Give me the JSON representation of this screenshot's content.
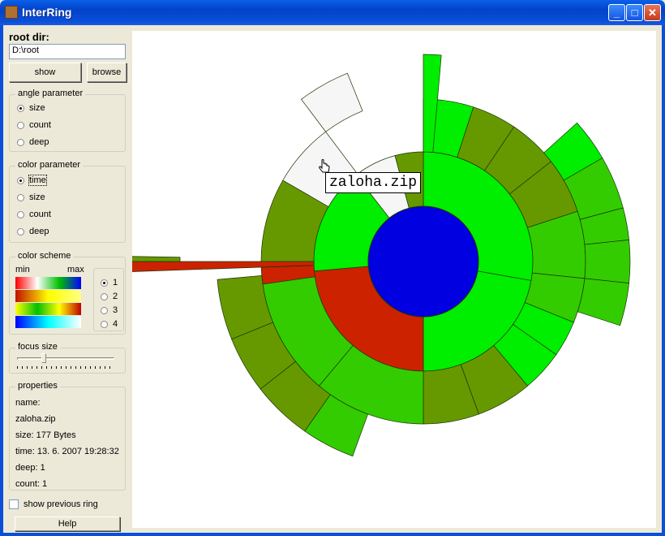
{
  "window": {
    "title": "InterRing",
    "min_label": "_",
    "max_label": "□",
    "close_label": "✕"
  },
  "root": {
    "label": "root dir:",
    "path": "D:\\root",
    "show_label": "show",
    "browse_label": "browse"
  },
  "angle_parameter": {
    "label": "angle parameter",
    "options": [
      "size",
      "count",
      "deep"
    ],
    "selected": "size"
  },
  "color_parameter": {
    "label": "color parameter",
    "options": [
      "time",
      "size",
      "count",
      "deep"
    ],
    "selected": "time"
  },
  "color_scheme": {
    "label": "color scheme",
    "min_label": "min",
    "max_label": "max",
    "options": [
      "1",
      "2",
      "3",
      "4"
    ],
    "selected": "1",
    "gradients": [
      [
        "#ff0000",
        "#ffffff",
        "#00c000",
        "#0000ff"
      ],
      [
        "#c01000",
        "#ffff00",
        "#ffff80"
      ],
      [
        "#ffff00",
        "#00c000",
        "#ffff00",
        "#c00000"
      ],
      [
        "#0000ff",
        "#00ffff",
        "#ffffff"
      ]
    ]
  },
  "focus_size": {
    "label": "focus size",
    "value": 0.26
  },
  "properties": {
    "label": "properties",
    "name_label": "name:",
    "name_value": "zaloha.zip",
    "size": "size: 177 Bytes",
    "time": "time: 13. 6. 2007 19:28:32",
    "deep": "deep: 1",
    "count": "count: 1"
  },
  "show_previous_ring": {
    "label": "show previous ring",
    "checked": false
  },
  "help_label": "Help",
  "tooltip": "zaloha.zip",
  "colors": {
    "center": "#0000e0",
    "bright_green": "#00ee00",
    "green": "#33cc00",
    "olive": "#669900",
    "red": "#cc2200",
    "white": "#f6f6f6"
  }
}
